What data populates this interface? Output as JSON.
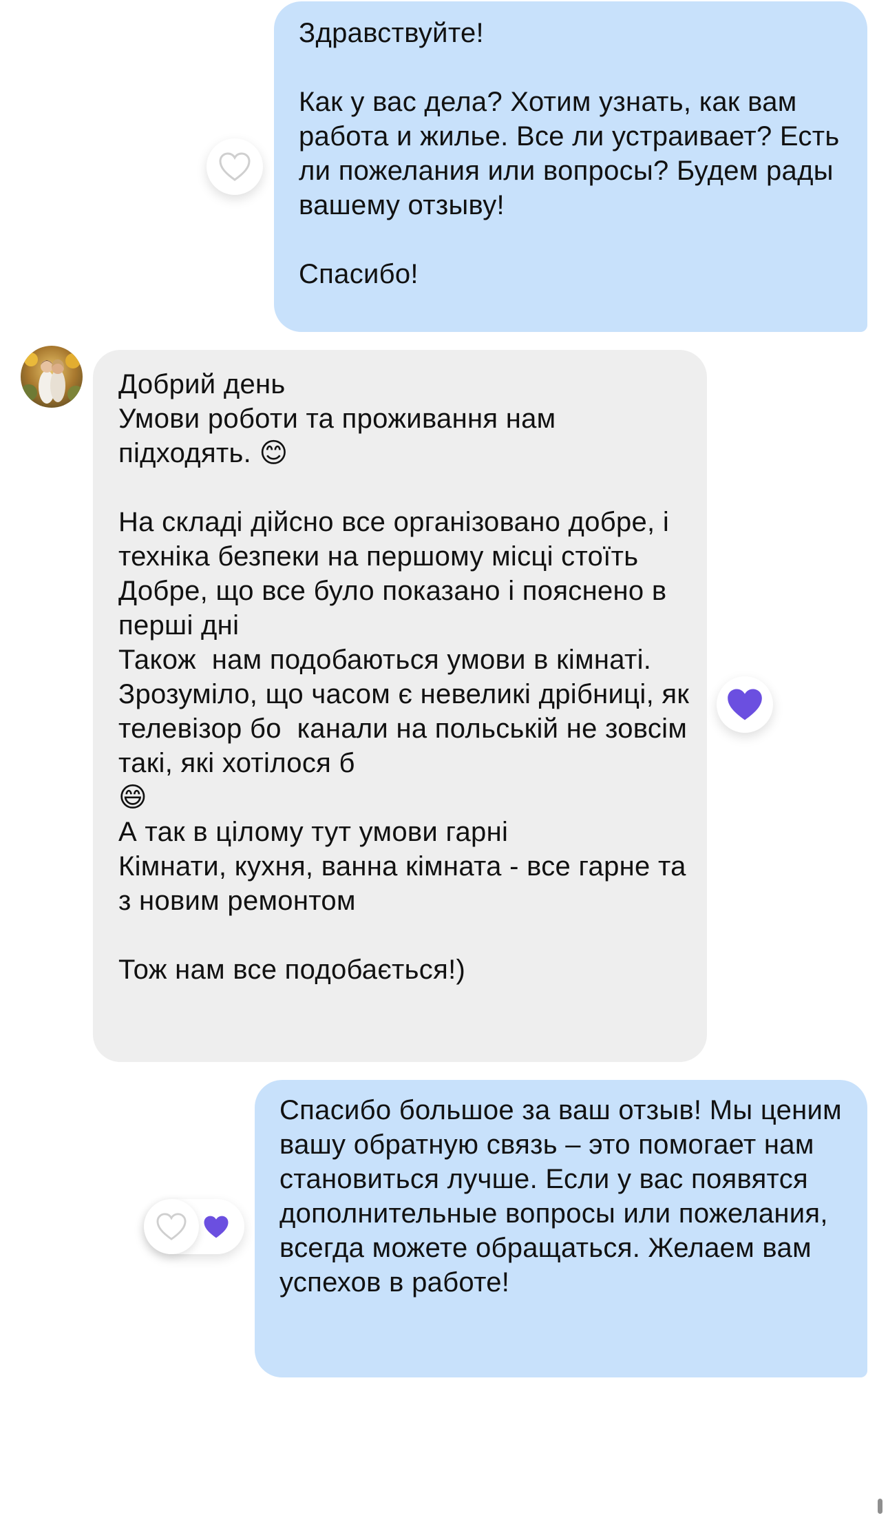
{
  "chat": {
    "messages": [
      {
        "direction": "outgoing",
        "text": "Здравствуйте!\n\nКак у вас дела? Хотим узнать, как вам работа и жилье. Все ли устраивает? Есть ли пожелания или вопросы? Будем рады вашему отзыву!\n\nСпасибо!",
        "reaction": "heart-outline-icon"
      },
      {
        "direction": "incoming",
        "text": "Добрий день\nУмови роботи та проживання нам підходять. 😊\n\nНа складі дійсно все організовано добре, і техніка безпеки на першому місці стоїть\nДобре, що все було показано і пояснено в перші дні\nТакож  нам подобаються умови в кімнаті. Зрозуміло, що часом є невеликі дрібниці, як телевізор бо  канали на польській не зовсім такі, які хотілося б\n😄\nА так в цілому тут умови гарні\nКімнати, кухня, ванна кімната - все гарне та з новим ремонтом\n\nТож нам все подобається!)",
        "reaction": "heart-filled-icon"
      },
      {
        "direction": "outgoing",
        "text": "Спасибо большое за ваш отзыв! Мы ценим вашу обратную связь – это помогает нам становиться лучше. Если у вас появятся дополнительные вопросы или пожелания, всегда можете обращаться. Желаем вам успехов в работе!",
        "reaction": [
          "heart-outline-icon",
          "heart-filled-icon"
        ]
      }
    ]
  },
  "colors": {
    "outgoing_bubble": "#c8e1fb",
    "incoming_bubble": "#eeeeee",
    "heart_filled": "#6b4fe0",
    "heart_outline": "#cfcfcf",
    "background": "#ffffff"
  }
}
